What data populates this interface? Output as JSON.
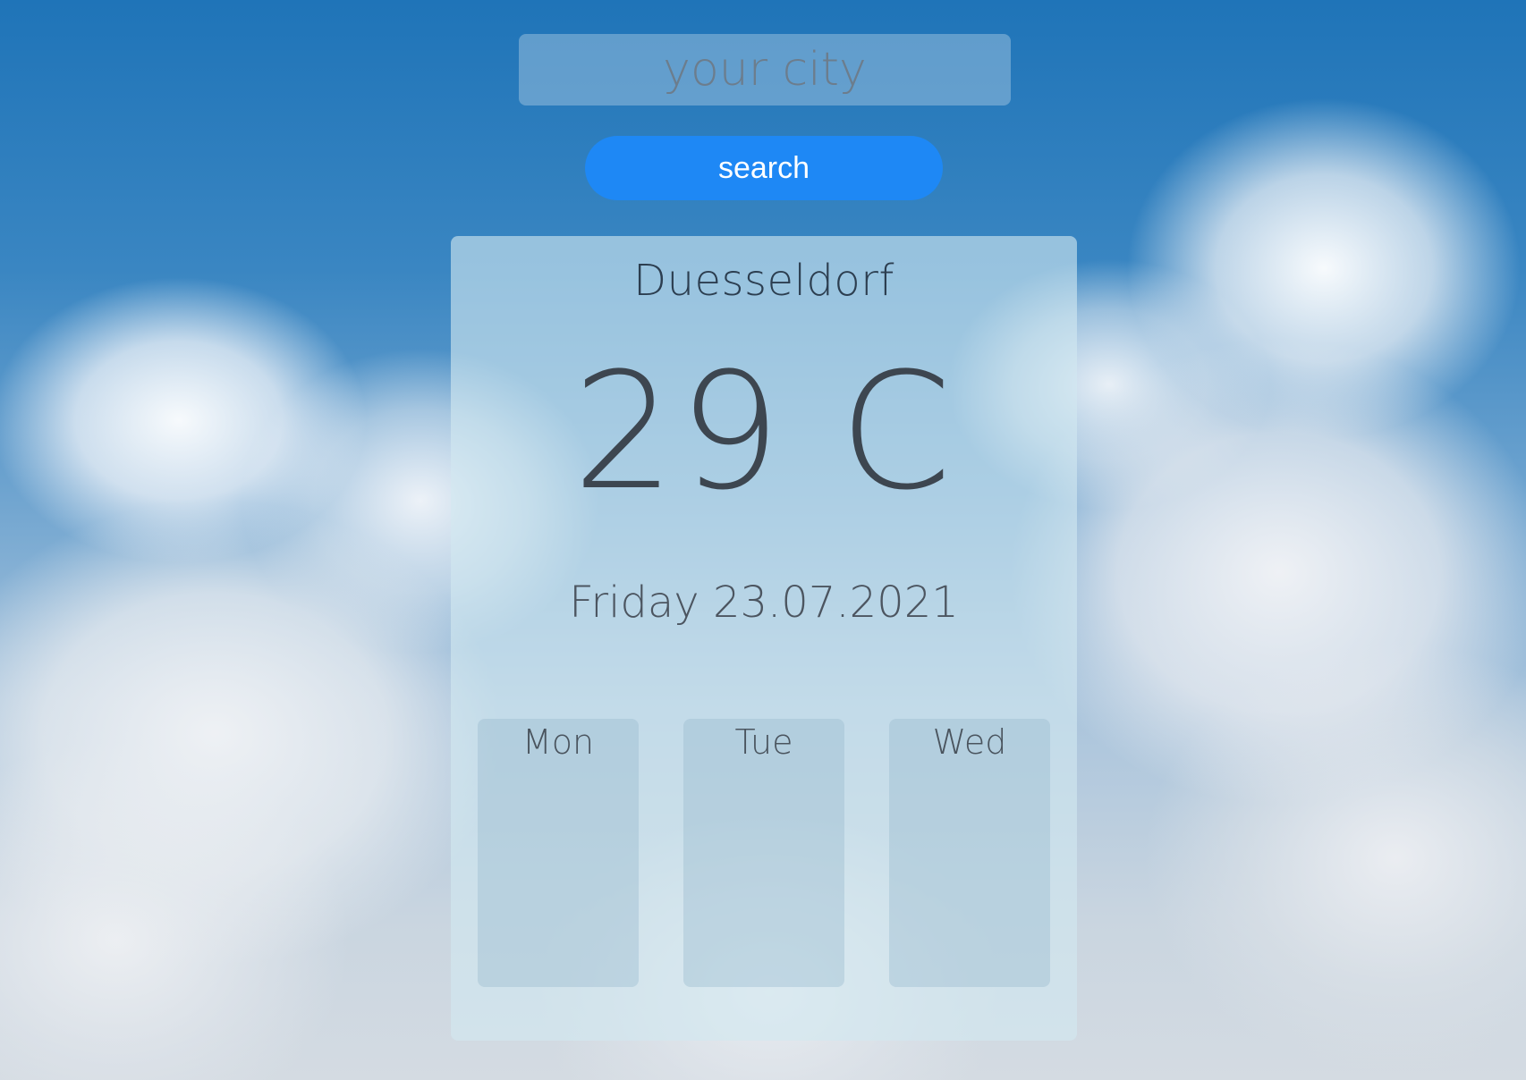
{
  "search": {
    "placeholder": "your city",
    "button_label": "search"
  },
  "weather": {
    "city": "Duesseldorf",
    "temperature": "29 C",
    "date": "Friday 23.07.2021"
  },
  "forecast": {
    "days": [
      {
        "label": "Mon"
      },
      {
        "label": "Tue"
      },
      {
        "label": "Wed"
      }
    ]
  },
  "colors": {
    "accent": "#1e88f5",
    "text_dark": "#2c3e50",
    "sky_top": "#1f74b8"
  }
}
